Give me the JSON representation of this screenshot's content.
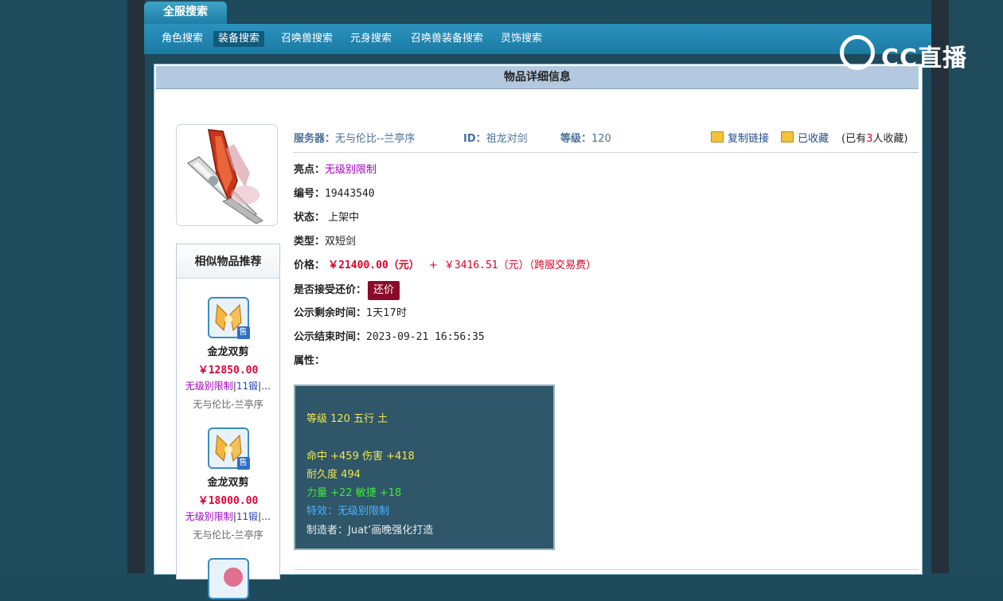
{
  "tab_title": "全服搜索",
  "nav": {
    "items": [
      {
        "label": "角色搜索",
        "active": false
      },
      {
        "label": "装备搜索",
        "active": true
      },
      {
        "label": "召唤兽搜索",
        "active": false
      },
      {
        "label": "元身搜索",
        "active": false
      },
      {
        "label": "召唤兽装备搜索",
        "active": false
      },
      {
        "label": "灵饰搜索",
        "active": false
      }
    ]
  },
  "watermark": "CC直播",
  "detail_header": "物品详细信息",
  "info_top": {
    "server_label": "服务器：",
    "server_value": "无与伦比--兰亭序",
    "id_label": "ID：",
    "id_value": "祖龙对剑",
    "level_label": "等级：",
    "level_value": "120",
    "copy_link": "复制链接",
    "favorited": "已收藏",
    "fav_prefix": "(已有",
    "fav_count": "3",
    "fav_suffix": "人收藏)"
  },
  "details": {
    "highlight_label": "亮点：",
    "highlight_value": "无级别限制",
    "number_label": "编号：",
    "number_value": "19443540",
    "status_label": "状态：",
    "status_value": "上架中",
    "type_label": "类型：",
    "type_value": "双短剑",
    "price_label": "价格：",
    "price_value": "￥21400.00（元）",
    "price_plus": "+",
    "fee_value": "￥3416.51（元）（跨服交易费）",
    "bargain_label": "是否接受还价：",
    "bargain_button": "还价",
    "remaining_label": "公示剩余时间：",
    "remaining_value": "1天17时",
    "end_label": "公示结束时间：",
    "end_value": "2023-09-21 16:56:35",
    "attr_label": "属性："
  },
  "attributes": {
    "line1": "等级 120 五行 土",
    "line2": "命中 +459 伤害 +418",
    "line3": "耐久度 494",
    "line4": "力量 +22 敏捷 +18",
    "line5": "特效：无级别限制",
    "line6": "制造者：Juat’画晚强化打造"
  },
  "similar": {
    "title": "相似物品推荐",
    "items": [
      {
        "name": "金龙双剪",
        "price": "￥12850.00",
        "tag1": "无级别限制",
        "tag2": "11锻",
        "tag3": "|…",
        "server": "无与伦比-兰亭序",
        "badge": "售"
      },
      {
        "name": "金龙双剪",
        "price": "￥18000.00",
        "tag1": "无级别限制",
        "tag2": "11锻",
        "tag3": "|…",
        "server": "无与伦比-兰亭序",
        "badge": "售"
      }
    ]
  }
}
